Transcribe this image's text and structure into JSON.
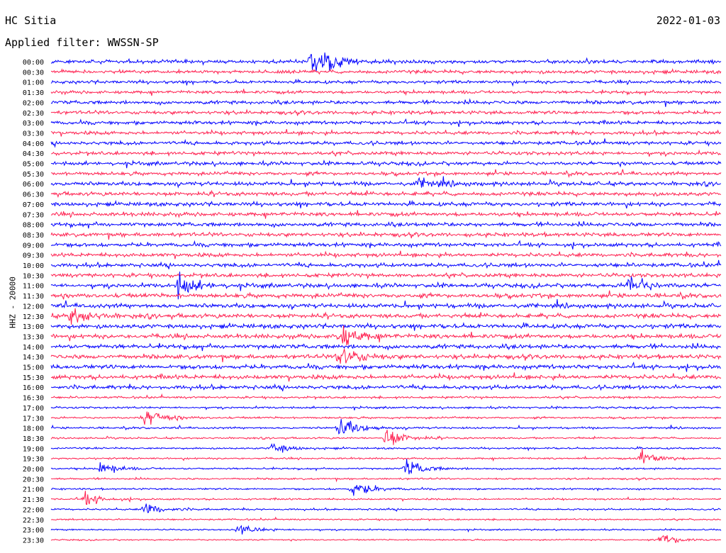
{
  "header": {
    "station": "HC Sitia",
    "date": "2022-01-03",
    "filter_text": "Applied filter: WWSSN-SP",
    "channel_label": "HHZ - 20000"
  },
  "colors": {
    "trace_a": "#0000ff",
    "trace_b": "#ff2050"
  },
  "chart_data": {
    "type": "line",
    "title": "HC Sitia",
    "subtitle": "Applied filter: WWSSN-SP",
    "date": "2022-01-03",
    "ylabel": "HHZ - 20000",
    "rows": [
      "00:00",
      "00:30",
      "01:00",
      "01:30",
      "02:00",
      "02:30",
      "03:00",
      "03:30",
      "04:00",
      "04:30",
      "05:00",
      "05:30",
      "06:00",
      "06:30",
      "07:00",
      "07:30",
      "08:00",
      "08:30",
      "09:00",
      "09:30",
      "10:00",
      "10:30",
      "11:00",
      "11:30",
      "12:00",
      "12:30",
      "13:00",
      "13:30",
      "14:00",
      "14:30",
      "15:00",
      "15:30",
      "16:00",
      "16:30",
      "17:00",
      "17:30",
      "18:00",
      "18:30",
      "19:00",
      "19:30",
      "20:00",
      "20:30",
      "21:00",
      "21:30",
      "22:00",
      "22:30",
      "23:00",
      "23:30"
    ],
    "row_noise_level": [
      0.9,
      0.9,
      0.8,
      0.8,
      0.9,
      0.9,
      0.9,
      0.9,
      0.9,
      0.9,
      0.9,
      0.9,
      1.0,
      1.0,
      1.0,
      1.0,
      1.0,
      1.0,
      1.0,
      1.0,
      1.0,
      1.0,
      1.0,
      1.1,
      1.1,
      1.1,
      1.1,
      1.1,
      1.1,
      1.1,
      1.1,
      1.1,
      1.0,
      0.55,
      0.5,
      0.5,
      0.5,
      0.45,
      0.45,
      0.45,
      0.45,
      0.45,
      0.45,
      0.45,
      0.45,
      0.4,
      0.35,
      0.35
    ],
    "events": [
      {
        "row": 0,
        "x_fraction": 0.39,
        "amplitude": 9.0
      },
      {
        "row": 12,
        "x_fraction": 0.55,
        "amplitude": 2.5
      },
      {
        "row": 22,
        "x_fraction": 0.19,
        "amplitude": 5.0
      },
      {
        "row": 22,
        "x_fraction": 0.86,
        "amplitude": 5.0
      },
      {
        "row": 25,
        "x_fraction": 0.03,
        "amplitude": 4.0
      },
      {
        "row": 27,
        "x_fraction": 0.43,
        "amplitude": 6.0
      },
      {
        "row": 29,
        "x_fraction": 0.43,
        "amplitude": 6.0
      },
      {
        "row": 35,
        "x_fraction": 0.14,
        "amplitude": 5.0
      },
      {
        "row": 36,
        "x_fraction": 0.43,
        "amplitude": 5.0
      },
      {
        "row": 37,
        "x_fraction": 0.5,
        "amplitude": 5.0
      },
      {
        "row": 38,
        "x_fraction": 0.33,
        "amplitude": 2.5
      },
      {
        "row": 39,
        "x_fraction": 0.88,
        "amplitude": 4.0
      },
      {
        "row": 40,
        "x_fraction": 0.07,
        "amplitude": 3.0
      },
      {
        "row": 40,
        "x_fraction": 0.53,
        "amplitude": 4.0
      },
      {
        "row": 42,
        "x_fraction": 0.45,
        "amplitude": 4.0
      },
      {
        "row": 43,
        "x_fraction": 0.05,
        "amplitude": 3.0
      },
      {
        "row": 44,
        "x_fraction": 0.14,
        "amplitude": 3.0
      },
      {
        "row": 46,
        "x_fraction": 0.28,
        "amplitude": 2.5
      },
      {
        "row": 47,
        "x_fraction": 0.91,
        "amplitude": 3.0
      }
    ]
  }
}
